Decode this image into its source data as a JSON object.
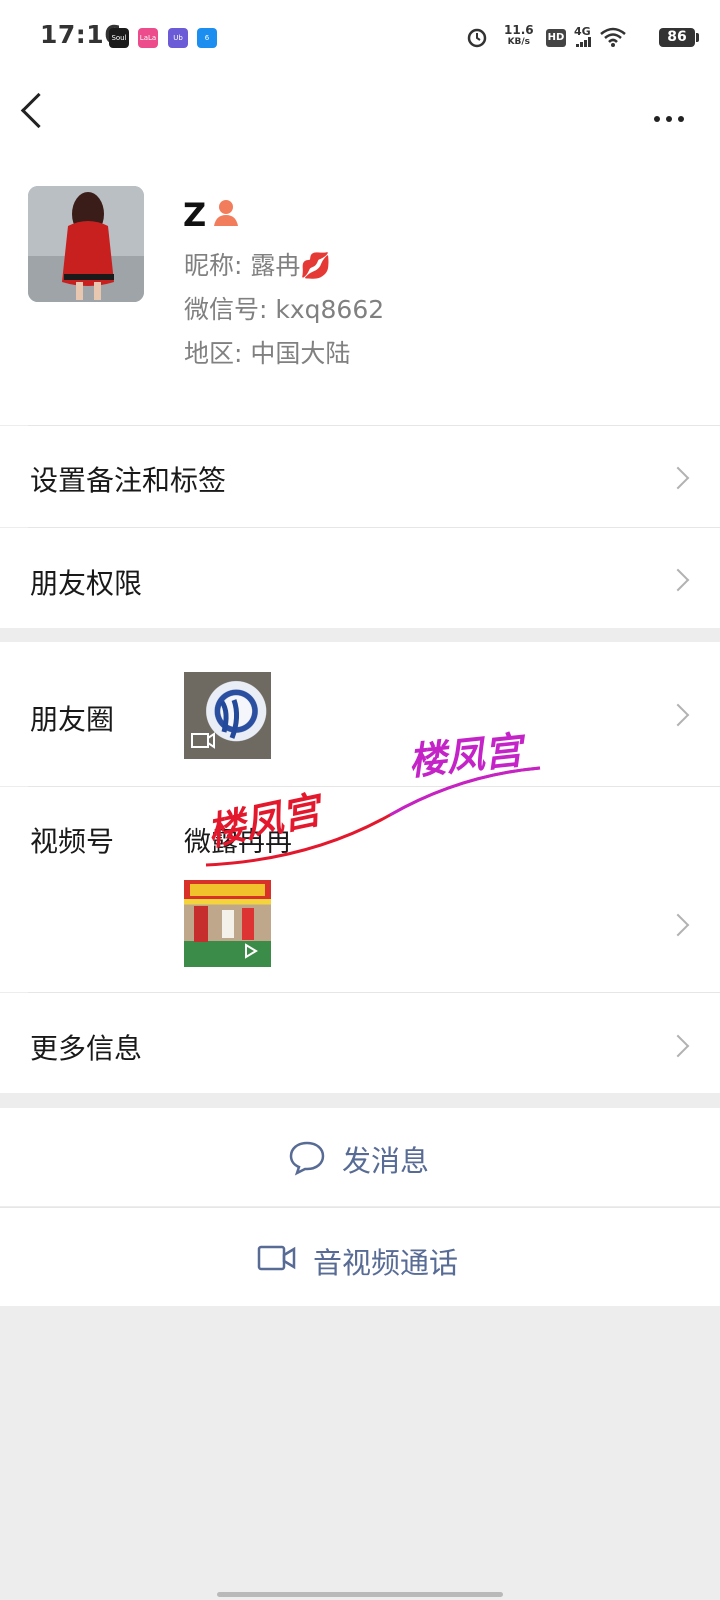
{
  "status_bar": {
    "time": "17:16",
    "app_icons": [
      "Soul",
      "LaLa",
      "Ub",
      "6"
    ],
    "speed_value": "11.6",
    "speed_unit": "KB/s",
    "hd": "HD",
    "network": "4G",
    "battery": "86"
  },
  "nav": {
    "back_icon": "chevron-left-icon",
    "more_icon": "more-icon"
  },
  "profile": {
    "name": "Z",
    "nickname": "昵称: 露冉💋",
    "wechat_id": "微信号: kxq8662",
    "region": "地区: 中国大陆"
  },
  "rows": {
    "remark": "设置备注和标签",
    "permission": "朋友权限",
    "moments": "朋友圈",
    "channels": "视频号",
    "channels_name": "微露冉冉",
    "more_info": "更多信息"
  },
  "watermark": {
    "text1": "楼凤宫",
    "text2": "楼凤宫"
  },
  "actions": {
    "send_message": "发消息",
    "video_call": "音视频通话"
  },
  "colors": {
    "link": "#576b95",
    "background": "#ededed",
    "watermark1": "#e3182c",
    "watermark2": "#c423c8"
  }
}
